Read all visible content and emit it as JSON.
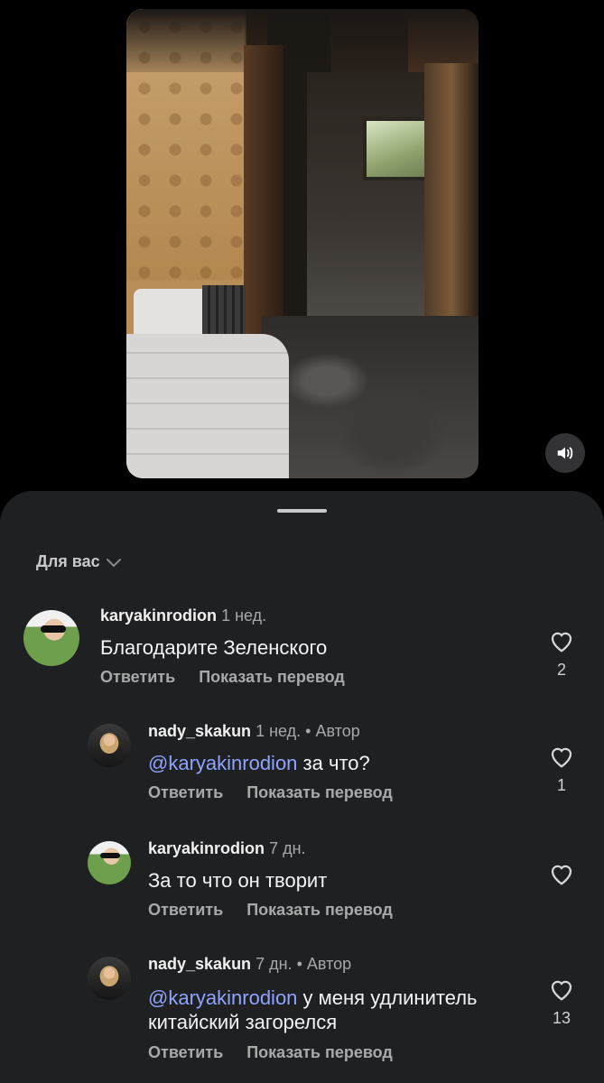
{
  "video": {
    "sound_icon": "speaker-icon"
  },
  "sheet": {
    "filter_label": "Для вас",
    "filter_icon": "chevron-down-icon"
  },
  "comments": [
    {
      "user": "karyakinrodion",
      "time": "1 нед.",
      "author_badge": "",
      "mention": "",
      "text": "Благодарите Зеленского",
      "reply_label": "Ответить",
      "translate_label": "Показать перевод",
      "likes": "2"
    },
    {
      "user": "nady_skakun",
      "time": "1 нед.",
      "author_badge": "Автор",
      "mention": "@karyakinrodion",
      "text": "за что?",
      "reply_label": "Ответить",
      "translate_label": "Показать перевод",
      "likes": "1"
    },
    {
      "user": "karyakinrodion",
      "time": "7 дн.",
      "author_badge": "",
      "mention": "",
      "text": "За то что он творит",
      "reply_label": "Ответить",
      "translate_label": "Показать перевод",
      "likes": ""
    },
    {
      "user": "nady_skakun",
      "time": "7 дн.",
      "author_badge": "Автор",
      "mention": "@karyakinrodion",
      "text": "у меня удлинитель китайский загорелся",
      "reply_label": "Ответить",
      "translate_label": "Показать перевод",
      "likes": "13"
    }
  ],
  "separator": "•",
  "colors": {
    "mention": "#8fa3ff",
    "sheet_bg": "#1f2022"
  }
}
